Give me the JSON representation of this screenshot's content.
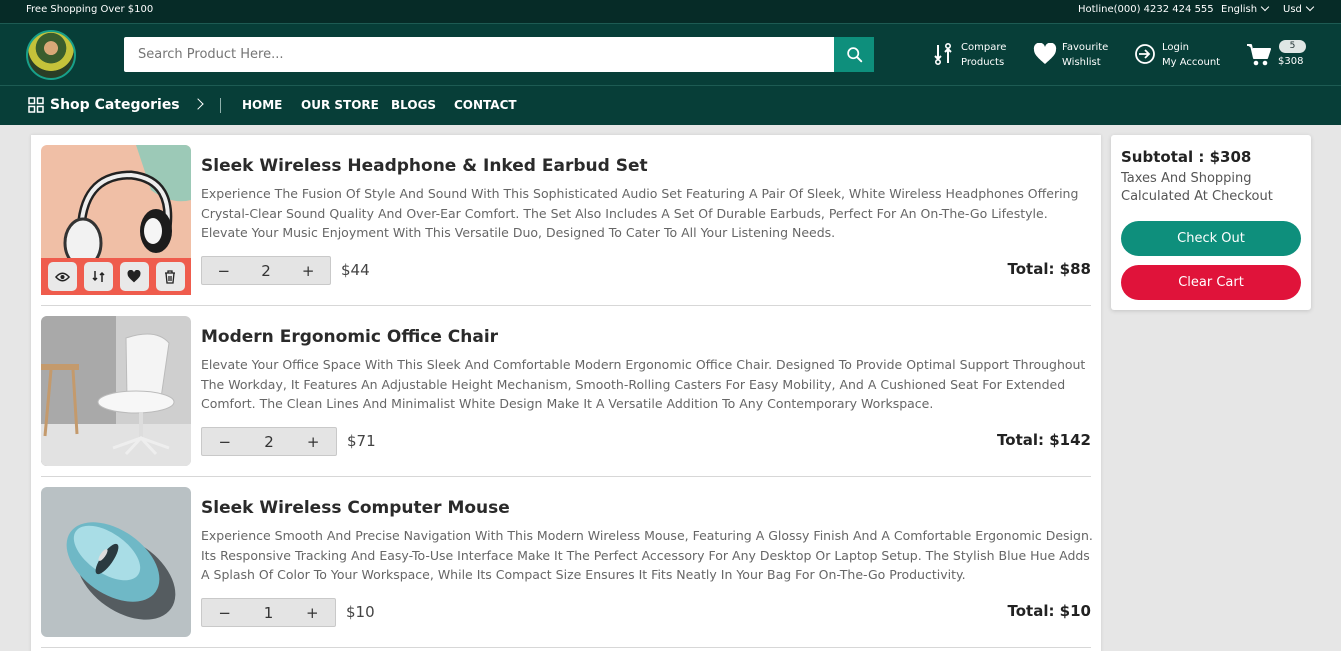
{
  "topbar": {
    "promo": "Free Shopping Over $100",
    "hotline": "Hotline(000) 4232 424 555",
    "language": "English",
    "currency": "Usd"
  },
  "header": {
    "search_placeholder": "Search Product Here...",
    "compare": [
      "Compare",
      "Products"
    ],
    "wishlist": [
      "Favourite",
      "Wishlist"
    ],
    "account": [
      "Login",
      "My Account"
    ],
    "cart_count": "5",
    "cart_total": "$308"
  },
  "nav": {
    "categories_label": "Shop Categories",
    "items": [
      "HOME",
      "OUR STORE",
      "BLOGS",
      "CONTACT"
    ]
  },
  "cart": {
    "items": [
      {
        "title": "Sleek Wireless Headphone & Inked Earbud Set",
        "description": "Experience The Fusion Of Style And Sound With This Sophisticated Audio Set Featuring A Pair Of Sleek, White Wireless Headphones Offering Crystal-Clear Sound Quality And Over-Ear Comfort. The Set Also Includes A Set Of Durable Earbuds, Perfect For An On-The-Go Lifestyle. Elevate Your Music Enjoyment With This Versatile Duo, Designed To Cater To All Your Listening Needs.",
        "quantity": "2",
        "price": "$44",
        "total": "Total: $88"
      },
      {
        "title": "Modern Ergonomic Office Chair",
        "description": "Elevate Your Office Space With This Sleek And Comfortable Modern Ergonomic Office Chair. Designed To Provide Optimal Support Throughout The Workday, It Features An Adjustable Height Mechanism, Smooth-Rolling Casters For Easy Mobility, And A Cushioned Seat For Extended Comfort. The Clean Lines And Minimalist White Design Make It A Versatile Addition To Any Contemporary Workspace.",
        "quantity": "2",
        "price": "$71",
        "total": "Total: $142"
      },
      {
        "title": "Sleek Wireless Computer Mouse",
        "description": "Experience Smooth And Precise Navigation With This Modern Wireless Mouse, Featuring A Glossy Finish And A Comfortable Ergonomic Design. Its Responsive Tracking And Easy-To-Use Interface Make It The Perfect Accessory For Any Desktop Or Laptop Setup. The Stylish Blue Hue Adds A Splash Of Color To Your Workspace, While Its Compact Size Ensures It Fits Neatly In Your Bag For On-The-Go Productivity.",
        "quantity": "1",
        "price": "$10",
        "total": "Total: $10"
      }
    ],
    "minus": "−",
    "plus": "+"
  },
  "summary": {
    "subtotal": "Subtotal : $308",
    "note": "Taxes And Shopping Calculated At Checkout",
    "checkout": "Check Out",
    "clear": "Clear Cart"
  },
  "colors": {
    "header_bg": "#073e38",
    "accent": "#0e8f7c",
    "danger": "#e0133a",
    "hover_actions": "#ef5c4d"
  }
}
